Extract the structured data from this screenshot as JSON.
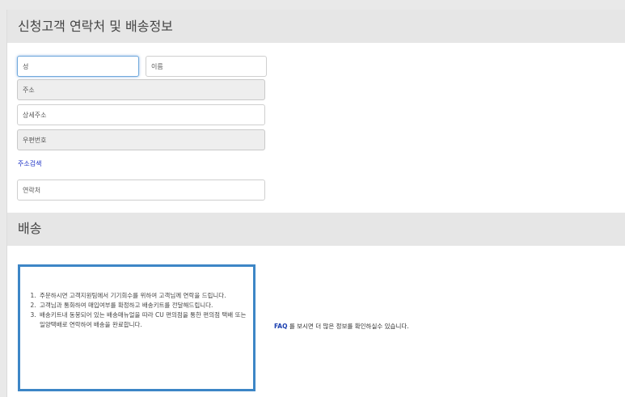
{
  "contact_section": {
    "title": "신청고객 연락처 및 배송정보"
  },
  "form": {
    "last_name_placeholder": "성",
    "first_name_placeholder": "이름",
    "address_placeholder": "주소",
    "address_detail_placeholder": "상세주소",
    "zipcode_placeholder": "우편번호",
    "address_search_label": "주소검색",
    "phone_placeholder": "연락처"
  },
  "shipping_section": {
    "title": "배송",
    "steps": [
      "주문하시면 고객지원팀에서 기기회수를 위하여 고객님께 연락을 드립니다.",
      "고객님과 통화하여 매입여부를 확정하고 배송키트를 전달해드립니다.",
      "배송키트내 동봉되어 있는 배송매뉴얼을 따라 CU 편의점을 통한 편의점 택배 또는 일양택배로 연락하여 배송을 완료합니다."
    ],
    "faq_link": "FAQ",
    "faq_text": " 를 보시면 더 많은 정보를 확인하실수 있습니다."
  },
  "colors": {
    "focus_border": "#6fa8dc",
    "notice_border": "#3d86c6",
    "link": "#1a2fc4"
  }
}
